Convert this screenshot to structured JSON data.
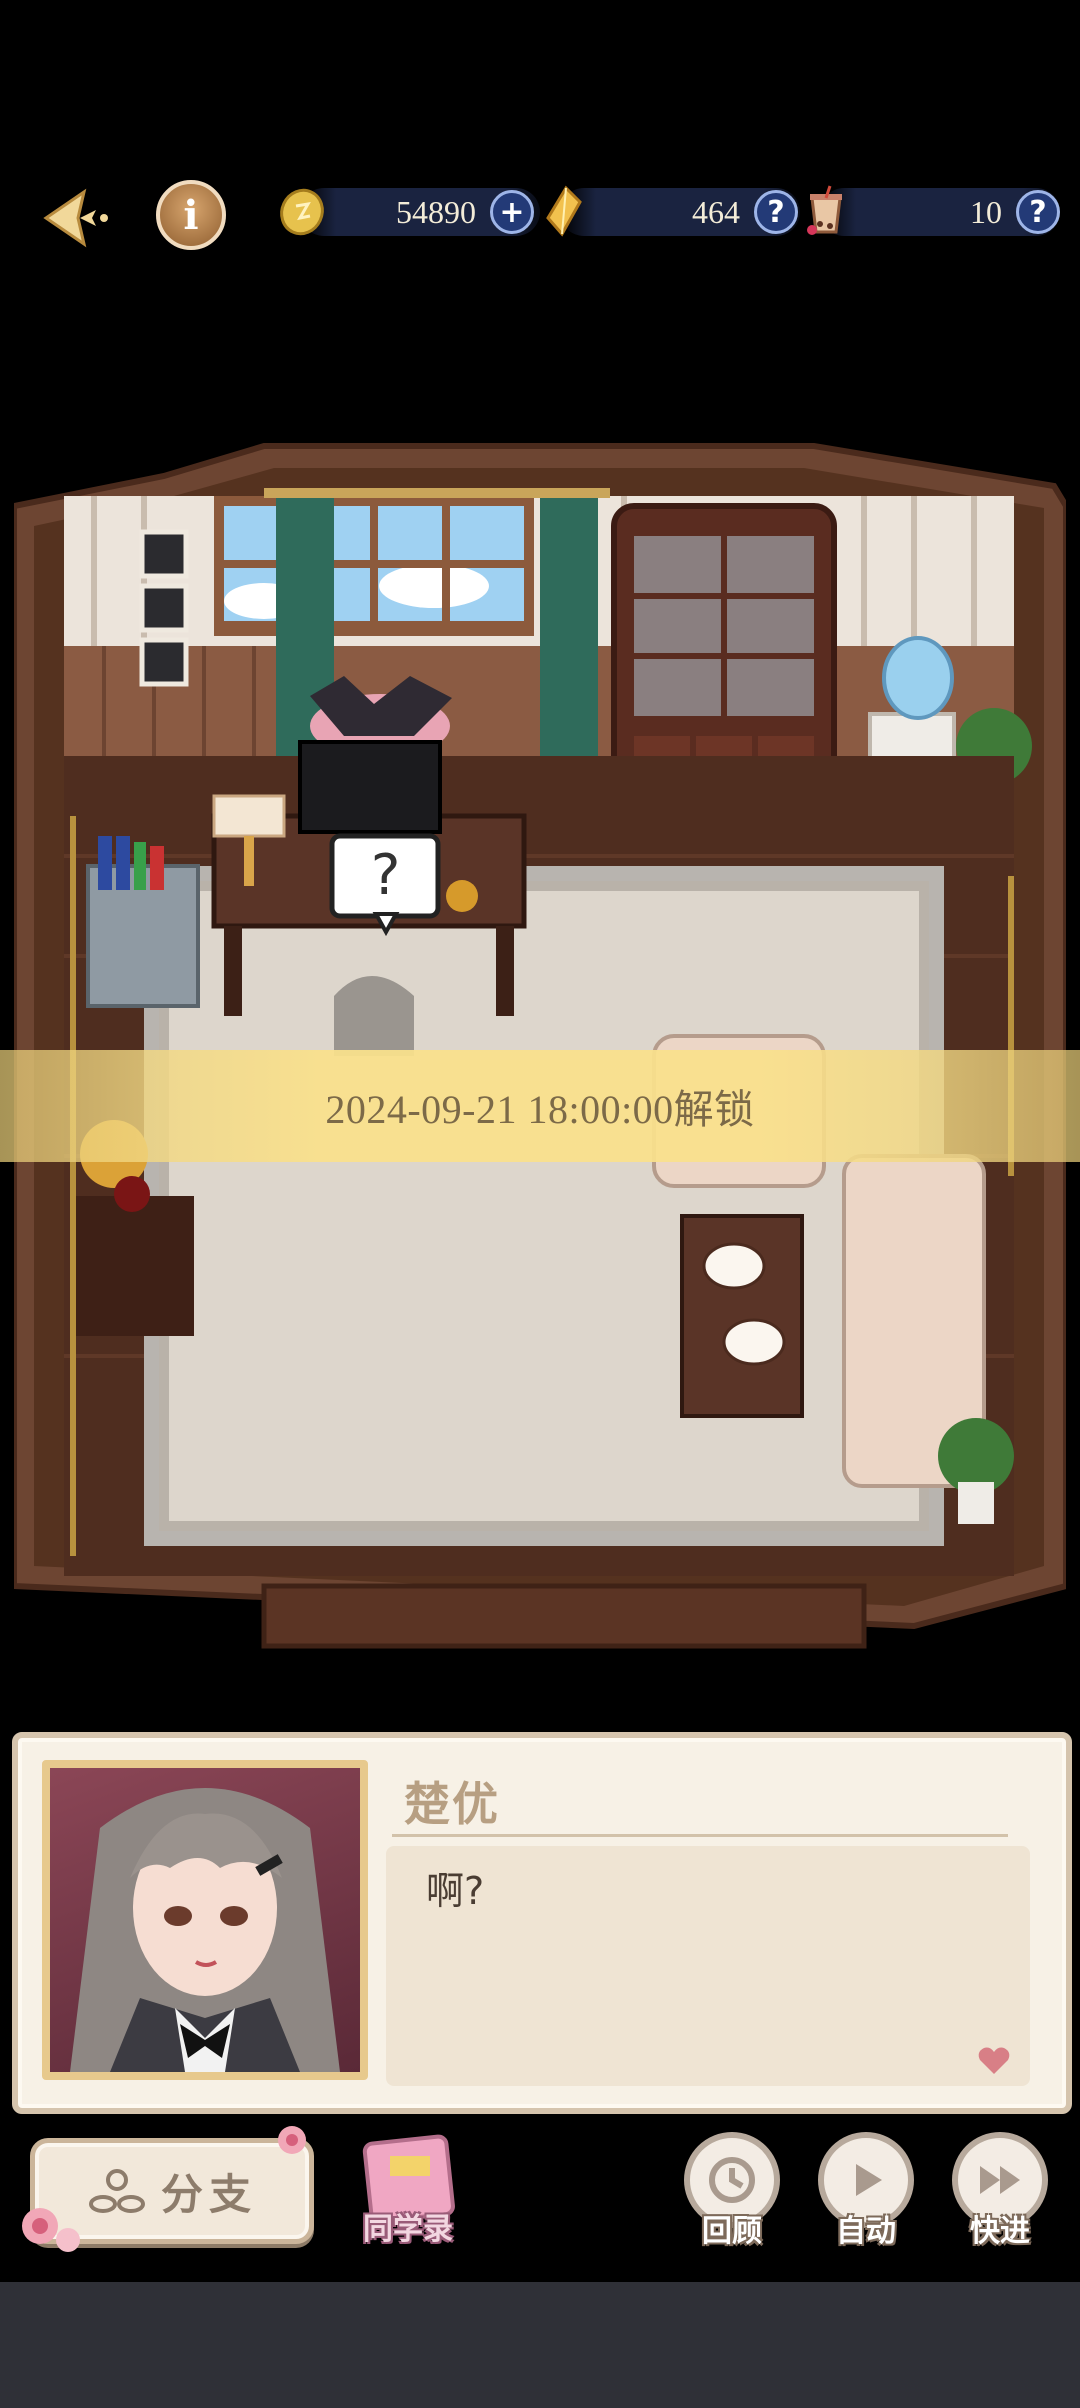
{
  "hud": {
    "coins": "54890",
    "crystals": "464",
    "drinks": "10",
    "add_symbol": "+",
    "help_symbol": "?",
    "info_symbol": "i"
  },
  "banner": {
    "unlock_text": "2024-09-21 18:00:00解锁"
  },
  "dialog": {
    "speaker": "楚优",
    "text": "啊?"
  },
  "controls": {
    "branch": "分支",
    "classmates": "同学录",
    "review": "回顾",
    "auto": "自动",
    "fast_forward": "快进"
  },
  "scene": {
    "bubble_symbol": "?"
  },
  "colors": {
    "accent_gold": "#e7c98d",
    "dialog_bg": "#f7f1e6",
    "resource_button": "#233a77"
  }
}
